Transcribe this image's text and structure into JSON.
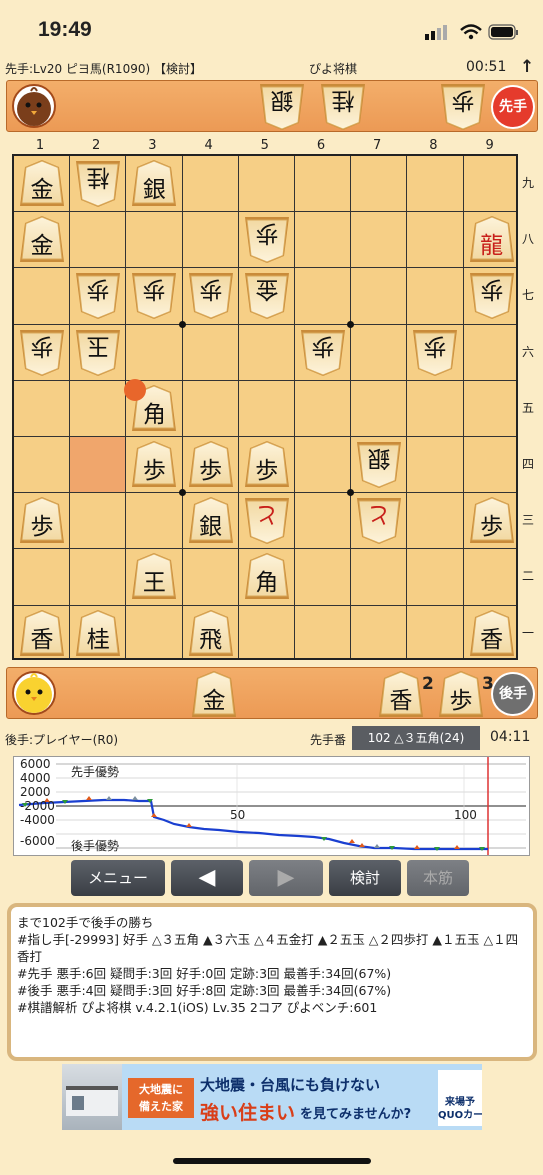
{
  "status": {
    "time": "19:49"
  },
  "header": {
    "sente_player": "先手:Lv20 ピヨ馬(R1090) 【検討】",
    "app_name": "ぴよ将棋",
    "timer": "00:51",
    "up_arrow": "↑"
  },
  "top_hand": {
    "avatar": "brown-chick-icon",
    "pieces": [
      {
        "label": "銀"
      },
      {
        "label": "桂"
      },
      {
        "label": "歩"
      }
    ],
    "badge": "先手",
    "badge_color": "#e53b2c"
  },
  "board": {
    "column_labels": [
      "1",
      "2",
      "3",
      "4",
      "5",
      "6",
      "7",
      "8",
      "9"
    ],
    "row_labels": [
      "九",
      "八",
      "七",
      "六",
      "五",
      "四",
      "三",
      "二",
      "一"
    ],
    "pieces": [
      {
        "col": 1,
        "row": 1,
        "label": "金",
        "owner": "self",
        "color": "black"
      },
      {
        "col": 2,
        "row": 1,
        "label": "桂",
        "owner": "opp",
        "color": "black"
      },
      {
        "col": 3,
        "row": 1,
        "label": "銀",
        "owner": "self",
        "color": "black"
      },
      {
        "col": 1,
        "row": 2,
        "label": "金",
        "owner": "self",
        "color": "black"
      },
      {
        "col": 5,
        "row": 2,
        "label": "歩",
        "owner": "opp",
        "color": "black"
      },
      {
        "col": 9,
        "row": 2,
        "label": "龍",
        "owner": "self",
        "color": "red"
      },
      {
        "col": 2,
        "row": 3,
        "label": "歩",
        "owner": "opp",
        "color": "black"
      },
      {
        "col": 3,
        "row": 3,
        "label": "歩",
        "owner": "opp",
        "color": "black"
      },
      {
        "col": 4,
        "row": 3,
        "label": "歩",
        "owner": "opp",
        "color": "black"
      },
      {
        "col": 5,
        "row": 3,
        "label": "金",
        "owner": "opp",
        "color": "black"
      },
      {
        "col": 9,
        "row": 3,
        "label": "歩",
        "owner": "opp",
        "color": "black"
      },
      {
        "col": 1,
        "row": 4,
        "label": "歩",
        "owner": "opp",
        "color": "black"
      },
      {
        "col": 2,
        "row": 4,
        "label": "玉",
        "owner": "opp",
        "color": "black"
      },
      {
        "col": 6,
        "row": 4,
        "label": "歩",
        "owner": "opp",
        "color": "black"
      },
      {
        "col": 8,
        "row": 4,
        "label": "歩",
        "owner": "opp",
        "color": "black"
      },
      {
        "col": 3,
        "row": 5,
        "label": "角",
        "owner": "self",
        "color": "black"
      },
      {
        "col": 3,
        "row": 6,
        "label": "歩",
        "owner": "self",
        "color": "black"
      },
      {
        "col": 4,
        "row": 6,
        "label": "歩",
        "owner": "self",
        "color": "black"
      },
      {
        "col": 5,
        "row": 6,
        "label": "歩",
        "owner": "self",
        "color": "black"
      },
      {
        "col": 7,
        "row": 6,
        "label": "銀",
        "owner": "opp",
        "color": "black"
      },
      {
        "col": 1,
        "row": 7,
        "label": "歩",
        "owner": "self",
        "color": "black"
      },
      {
        "col": 4,
        "row": 7,
        "label": "銀",
        "owner": "self",
        "color": "black"
      },
      {
        "col": 5,
        "row": 7,
        "label": "と",
        "owner": "opp",
        "color": "red"
      },
      {
        "col": 7,
        "row": 7,
        "label": "と",
        "owner": "opp",
        "color": "red"
      },
      {
        "col": 9,
        "row": 7,
        "label": "歩",
        "owner": "self",
        "color": "black"
      },
      {
        "col": 3,
        "row": 8,
        "label": "王",
        "owner": "self",
        "color": "black"
      },
      {
        "col": 5,
        "row": 8,
        "label": "角",
        "owner": "self",
        "color": "black"
      },
      {
        "col": 1,
        "row": 9,
        "label": "香",
        "owner": "self",
        "color": "black"
      },
      {
        "col": 2,
        "row": 9,
        "label": "桂",
        "owner": "self",
        "color": "black"
      },
      {
        "col": 4,
        "row": 9,
        "label": "飛",
        "owner": "self",
        "color": "black"
      },
      {
        "col": 9,
        "row": 9,
        "label": "香",
        "owner": "self",
        "color": "black"
      }
    ],
    "highlight_square": {
      "col": 2,
      "row": 6
    },
    "last_move_marker": {
      "col": 3,
      "row": 5
    }
  },
  "bottom_hand": {
    "avatar": "yellow-chick-icon",
    "pieces": [
      {
        "label": "金",
        "count": ""
      },
      {
        "label": "香",
        "count": "2"
      },
      {
        "label": "歩",
        "count": "3"
      }
    ],
    "badge": "後手",
    "badge_color": "#6f6f6f"
  },
  "info_bar": {
    "gote_player": "後手:プレイヤー(R0)",
    "turn_label": "先手番",
    "move_text": "102 △３五角(24)",
    "time": "04:11"
  },
  "graph": {
    "y_labels": [
      "6000",
      "4000",
      "2000",
      "-2000",
      "-4000",
      "-6000"
    ],
    "top_text": "先手優勢",
    "bottom_text": "後手優勢",
    "x_labels": [
      "50",
      "100"
    ]
  },
  "buttons": [
    {
      "name": "menu-button",
      "label": "メニュー",
      "enabled": true
    },
    {
      "name": "prev-button",
      "label": "◀",
      "enabled": true
    },
    {
      "name": "next-button",
      "label": "▶",
      "enabled": false
    },
    {
      "name": "review-button",
      "label": "検討",
      "enabled": true
    },
    {
      "name": "mainline-button",
      "label": "本筋",
      "enabled": false
    }
  ],
  "log": {
    "text": "まで102手で後手の勝ち\n#指し手[-29993] 好手 △３五角 ▲３六玉 △４五金打 ▲２五玉 △２四歩打 ▲１五玉 △１四香打\n#先手 悪手:6回 疑問手:3回 好手:0回 定跡:3回 最善手:34回(67%)\n#後手 悪手:4回 疑問手:3回 好手:8回 定跡:3回 最善手:34回(67%)\n#棋譜解析 ぴよ将棋 v.4.2.1(iOS) Lv.35 2コア ぴよベンチ:601"
  },
  "ad": {
    "badge": "大地震に\n備えた家",
    "line1": "大地震・台風にも負けない",
    "line2a": "強い住まい",
    "line2b": "を見てみませんか?",
    "side": "来場予\nQUOカード"
  }
}
